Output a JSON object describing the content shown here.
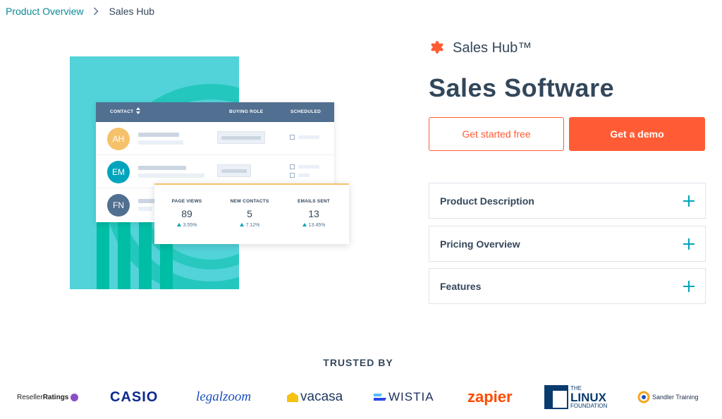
{
  "breadcrumb": {
    "parent": "Product Overview",
    "current": "Sales Hub"
  },
  "hero": {
    "table_headers": [
      "CONTACT",
      "BUYING ROLE",
      "SCHEDULED"
    ],
    "contacts": [
      {
        "initials": "AH",
        "color": "#f5c26b"
      },
      {
        "initials": "EM",
        "color": "#00a4bd"
      },
      {
        "initials": "FN",
        "color": "#516f90"
      }
    ],
    "stats": [
      {
        "label": "PAGE VIEWS",
        "value": "89",
        "change": "3.55%"
      },
      {
        "label": "NEW CONTACTS",
        "value": "5",
        "change": "7.12%"
      },
      {
        "label": "EMAILS SENT",
        "value": "13",
        "change": "13.45%"
      }
    ]
  },
  "product": {
    "name": "Sales Hub™",
    "title": "Sales Software"
  },
  "cta": {
    "primary": "Get started free",
    "secondary": "Get a demo"
  },
  "accordion": [
    "Product Description",
    "Pricing Overview",
    "Features"
  ],
  "trusted": {
    "title": "TRUSTED BY",
    "logos": {
      "reseller_a": "Reseller",
      "reseller_b": "Ratings",
      "casio": "CASIO",
      "legalzoom": "legalzoom",
      "vacasa": "vacasa",
      "wistia": "WISTIA",
      "zapier": "zapier",
      "linux_the": "THE",
      "linux_name": "LINUX",
      "linux_foundation": "FOUNDATION",
      "sandler": "Sandler Training"
    }
  },
  "colors": {
    "accent": "#ff5c35",
    "teal": "#00a4bd",
    "text": "#33475b"
  }
}
